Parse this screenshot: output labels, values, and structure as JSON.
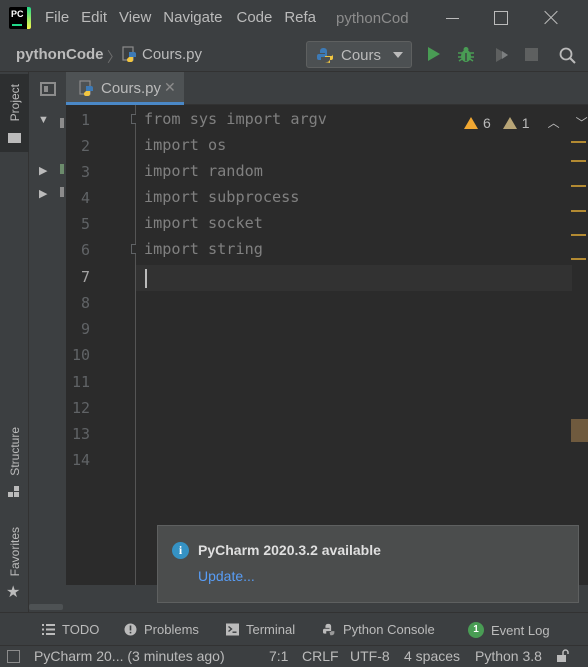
{
  "window": {
    "menu": [
      "File",
      "Edit",
      "View",
      "Navigate",
      "Code",
      "Refa"
    ],
    "project_title": "pythonCod"
  },
  "navbar": {
    "project": "pythonCode",
    "file": "Cours.py",
    "run_config": "Cours"
  },
  "left_strip": {
    "project": "Project",
    "structure": "Structure",
    "favorites": "Favorites"
  },
  "editor": {
    "tab_label": "Cours.py",
    "inspection": {
      "warnings": "6",
      "weak_warnings": "1"
    },
    "lines": [
      {
        "num": "1",
        "kw": "from",
        "rest": " sys ",
        "kw2": "import",
        "rest2": " argv"
      },
      {
        "num": "2",
        "kw": "import",
        "rest": " os"
      },
      {
        "num": "3",
        "kw": "import",
        "rest": " random"
      },
      {
        "num": "4",
        "kw": "import",
        "rest": " subprocess"
      },
      {
        "num": "5",
        "kw": "import",
        "rest": " socket"
      },
      {
        "num": "6",
        "kw": "import",
        "rest": " string"
      },
      {
        "num": "7"
      },
      {
        "num": "8"
      },
      {
        "num": "9"
      },
      {
        "num": "10"
      },
      {
        "num": "11"
      },
      {
        "num": "12"
      },
      {
        "num": "13"
      },
      {
        "num": "14"
      }
    ]
  },
  "notification": {
    "title": "PyCharm 2020.3.2 available",
    "link": "Update..."
  },
  "bottom_tabs": {
    "todo": "TODO",
    "problems": "Problems",
    "terminal": "Terminal",
    "python_console": "Python Console",
    "event_log_badge": "1",
    "event_log": "Event Log"
  },
  "status": {
    "message": "PyCharm 20... (3 minutes ago)",
    "position": "7:1",
    "line_sep": "CRLF",
    "encoding": "UTF-8",
    "indent": "4 spaces",
    "interpreter": "Python 3.8"
  },
  "colors": {
    "keyword": "#cc7832",
    "identifier": "#a9b7c6",
    "editor_bg": "#2b2b2b",
    "chrome_bg": "#3c3f41",
    "accent": "#4a88c7",
    "run_green": "#499c54",
    "warning": "#f0a732"
  }
}
